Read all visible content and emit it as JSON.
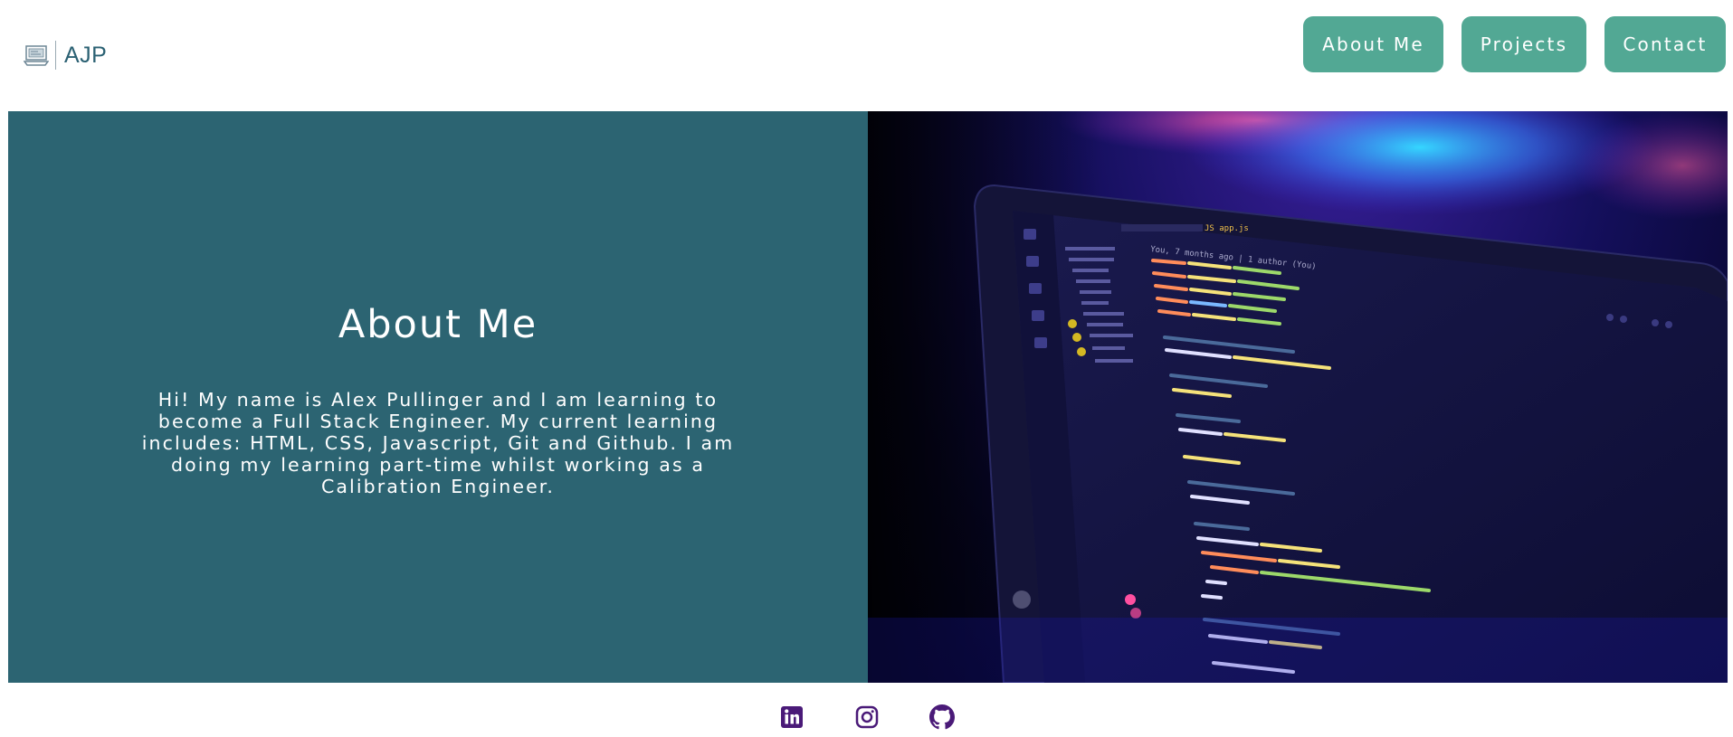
{
  "brand": {
    "name": "AJP",
    "icon": "laptop-logo-icon",
    "color": "#2b6173"
  },
  "nav": {
    "items": [
      {
        "label": "About Me"
      },
      {
        "label": "Projects"
      },
      {
        "label": "Contact"
      }
    ],
    "button_color": "#52a894"
  },
  "about": {
    "title": "About Me",
    "text": "Hi! My name is Alex Pullinger and I am learning to become a Full Stack Engineer. My current learning includes: HTML, CSS, Javascript, Git and Github. I am doing my learning part-time whilst working as a Calibration Engineer.",
    "panel_color": "#2c6472"
  },
  "hero_image": {
    "description_icon": "laptop-code-photo"
  },
  "social": [
    {
      "icon": "linkedin-icon"
    },
    {
      "icon": "instagram-icon"
    },
    {
      "icon": "github-icon"
    }
  ],
  "colors": {
    "social_icon": "#4a1a78"
  }
}
